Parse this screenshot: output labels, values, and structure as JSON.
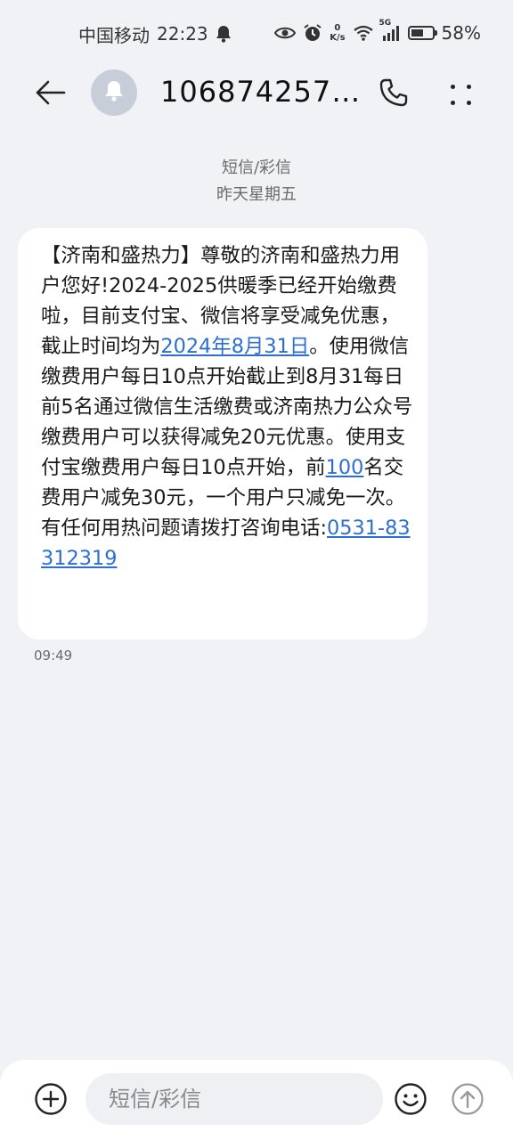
{
  "status_bar": {
    "carrier": "中国移动",
    "time": "22:23",
    "net_speed_value": "0",
    "net_speed_unit": "K/s",
    "network_type": "5G",
    "battery_percent": "58%",
    "battery_level": 0.58
  },
  "header": {
    "contact": "1068742577…"
  },
  "conversation": {
    "type_label": "短信/彩信",
    "date_label": "昨天星期五"
  },
  "message": {
    "segments": [
      {
        "text": "【济南和盛热力】尊敬的济南和盛热力用户您好!",
        "link": false
      },
      {
        "text": "2024-2025供暖季已经开始缴费啦，目前支付宝、微信将享受减免优惠，截止时间均为",
        "link": false
      },
      {
        "text": "2024年8月31日",
        "link": true
      },
      {
        "text": "。使用微信缴费用户每日10点开始截止到8月31每日前5名通过微信生活缴费或济南热力公众号缴费用户可以获得减免20元优惠。使用支付宝缴费用户每日10点开始，前",
        "link": false
      },
      {
        "text": "100",
        "link": true
      },
      {
        "text": "名交费用户减免30元，一个用户只减免一次。有任何用热问题请拨打咨询电话:",
        "link": false
      },
      {
        "text": "0531-83312319",
        "link": true
      }
    ],
    "time": "09:49"
  },
  "input_bar": {
    "placeholder": "短信/彩信"
  },
  "colors": {
    "background": "#f1f2f5",
    "bubble": "#ffffff",
    "link": "#2c6fd1",
    "avatar": "#c8ced9"
  },
  "icons": [
    "bell-icon",
    "eye-icon",
    "alarm-icon",
    "wifi-icon",
    "signal-icon",
    "battery-icon",
    "back-arrow-icon",
    "notification-bell-icon",
    "phone-icon",
    "more-icon",
    "add-icon",
    "emoji-icon",
    "send-icon"
  ]
}
